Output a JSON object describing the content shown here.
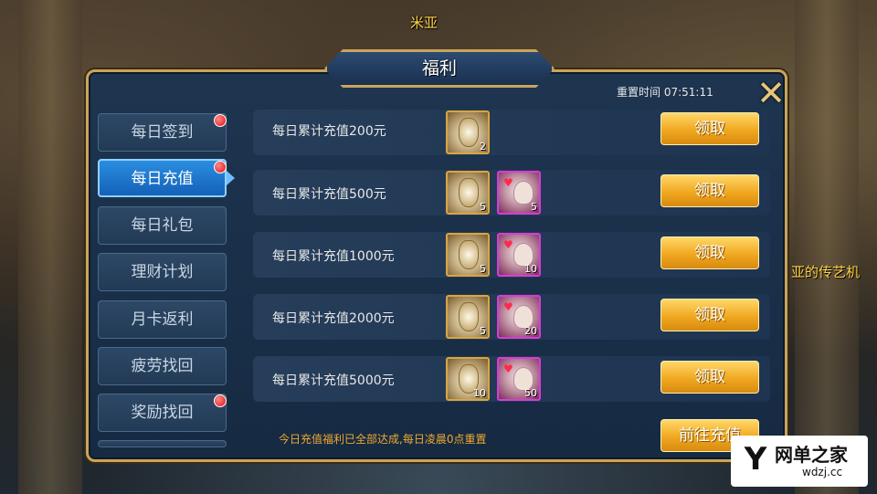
{
  "scene": {
    "name": "米亚",
    "side_text": "亚的传艺机"
  },
  "panel": {
    "title": "福利",
    "reset_time": "重置时间 07:51:11",
    "close_icon": "close-x-icon"
  },
  "menu": [
    {
      "label": "每日签到",
      "active": false,
      "red_dot": true
    },
    {
      "label": "每日充值",
      "active": true,
      "red_dot": true
    },
    {
      "label": "每日礼包",
      "active": false,
      "red_dot": false
    },
    {
      "label": "理财计划",
      "active": false,
      "red_dot": false
    },
    {
      "label": "月卡返利",
      "active": false,
      "red_dot": false
    },
    {
      "label": "疲劳找回",
      "active": false,
      "red_dot": false
    },
    {
      "label": "奖励找回",
      "active": false,
      "red_dot": true
    }
  ],
  "rows": [
    {
      "label": "每日累计充值200元",
      "items": [
        {
          "icon": "gold-vase-icon",
          "qty": "2"
        }
      ],
      "button": "领取"
    },
    {
      "label": "每日累计充值500元",
      "items": [
        {
          "icon": "gold-vase-icon",
          "qty": "5"
        },
        {
          "icon": "hero-card-icon",
          "qty": "5"
        }
      ],
      "button": "领取"
    },
    {
      "label": "每日累计充值1000元",
      "items": [
        {
          "icon": "gold-vase-icon",
          "qty": "5"
        },
        {
          "icon": "hero-card-icon",
          "qty": "10"
        }
      ],
      "button": "领取"
    },
    {
      "label": "每日累计充值2000元",
      "items": [
        {
          "icon": "gold-vase-icon",
          "qty": "5"
        },
        {
          "icon": "hero-card-icon",
          "qty": "20"
        }
      ],
      "button": "领取"
    },
    {
      "label": "每日累计充值5000元",
      "items": [
        {
          "icon": "gold-vase-icon",
          "qty": "10"
        },
        {
          "icon": "hero-card-icon",
          "qty": "50"
        }
      ],
      "button": "领取"
    }
  ],
  "footer": {
    "note": "今日充值福利已全部达成,每日凌晨0点重置",
    "go_button": "前往充值"
  },
  "watermark": {
    "cn": "网单之家",
    "en": "wdzj.cc",
    "mark": "Y"
  },
  "colors": {
    "gold": "#f0a820",
    "active_tab": "#1461b8",
    "red_dot": "#e01010",
    "note": "#f0a830"
  }
}
